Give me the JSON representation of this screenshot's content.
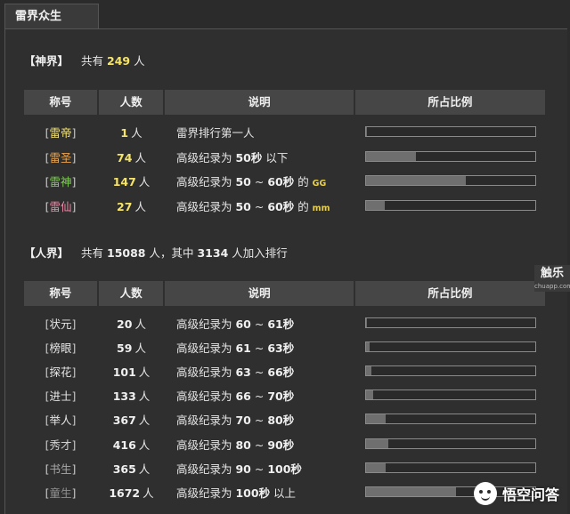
{
  "tab": {
    "label": "雷界众生"
  },
  "shen": {
    "bracket": "【神界】",
    "prefix": "共有",
    "count": "249",
    "suffix": "人",
    "headers": [
      "称号",
      "人数",
      "说明",
      "所占比例"
    ],
    "rows": [
      {
        "title": "雷帝",
        "color": "#f6e46a",
        "count": "1",
        "unit": "人",
        "desc_pre": "雷界排行第一人",
        "desc_b1": "",
        "desc_mid": "",
        "desc_b2": "",
        "desc_post": "",
        "small": "",
        "ratio": 0.004,
        "count_color": "#f6e46a"
      },
      {
        "title": "雷圣",
        "color": "#f0a64a",
        "count": "74",
        "unit": "人",
        "desc_pre": "高级纪录为 ",
        "desc_b1": "50秒",
        "desc_mid": " 以下",
        "desc_b2": "",
        "desc_post": "",
        "small": "",
        "ratio": 0.297,
        "count_color": "#f6e46a"
      },
      {
        "title": "雷神",
        "color": "#7bd24c",
        "count": "147",
        "unit": "人",
        "desc_pre": "高级纪录为 ",
        "desc_b1": "50",
        "desc_mid": " ~ ",
        "desc_b2": "60秒",
        "desc_post": " 的 ",
        "small": "GG",
        "small_color": "#e8d04a",
        "ratio": 0.59,
        "count_color": "#f6e46a"
      },
      {
        "title": "雷仙",
        "color": "#f08aa8",
        "count": "27",
        "unit": "人",
        "desc_pre": "高级纪录为 ",
        "desc_b1": "50",
        "desc_mid": " ~ ",
        "desc_b2": "60秒",
        "desc_post": " 的 ",
        "small": "mm",
        "small_color": "#e8d04a",
        "ratio": 0.108,
        "count_color": "#f6e46a"
      }
    ]
  },
  "ren": {
    "bracket": "【人界】",
    "prefix": "共有",
    "count": "15088",
    "mid": "人，其中",
    "count2": "3134",
    "suffix": "人加入排行",
    "headers": [
      "称号",
      "人数",
      "说明",
      "所占比例"
    ],
    "rows": [
      {
        "title": "状元",
        "color": "#e6e6e6",
        "count": "20",
        "unit": "人",
        "desc_pre": "高级纪录为 ",
        "desc_b1": "60",
        "desc_mid": " ~ ",
        "desc_b2": "61秒",
        "desc_post": "",
        "ratio": 0.006
      },
      {
        "title": "榜眼",
        "color": "#e6e6e6",
        "count": "59",
        "unit": "人",
        "desc_pre": "高级纪录为 ",
        "desc_b1": "61",
        "desc_mid": " ~ ",
        "desc_b2": "63秒",
        "desc_post": "",
        "ratio": 0.019
      },
      {
        "title": "探花",
        "color": "#e6e6e6",
        "count": "101",
        "unit": "人",
        "desc_pre": "高级纪录为 ",
        "desc_b1": "63",
        "desc_mid": " ~ ",
        "desc_b2": "66秒",
        "desc_post": "",
        "ratio": 0.032
      },
      {
        "title": "进士",
        "color": "#e6e6e6",
        "count": "133",
        "unit": "人",
        "desc_pre": "高级纪录为 ",
        "desc_b1": "66",
        "desc_mid": " ~ ",
        "desc_b2": "70秒",
        "desc_post": "",
        "ratio": 0.042
      },
      {
        "title": "举人",
        "color": "#e6e6e6",
        "count": "367",
        "unit": "人",
        "desc_pre": "高级纪录为 ",
        "desc_b1": "70",
        "desc_mid": " ~ ",
        "desc_b2": "80秒",
        "desc_post": "",
        "ratio": 0.117
      },
      {
        "title": "秀才",
        "color": "#d0d0d0",
        "count": "416",
        "unit": "人",
        "desc_pre": "高级纪录为 ",
        "desc_b1": "80",
        "desc_mid": " ~ ",
        "desc_b2": "90秒",
        "desc_post": "",
        "ratio": 0.133
      },
      {
        "title": "书生",
        "color": "#a8a8a8",
        "count": "365",
        "unit": "人",
        "desc_pre": "高级纪录为 ",
        "desc_b1": "90",
        "desc_mid": " ~ ",
        "desc_b2": "100秒",
        "desc_post": "",
        "ratio": 0.116
      },
      {
        "title": "童生",
        "color": "#909090",
        "count": "1672",
        "unit": "人",
        "desc_pre": "高级纪录为 ",
        "desc_b1": "100秒",
        "desc_mid": " 以上",
        "desc_b2": "",
        "desc_post": "",
        "ratio": 0.533
      }
    ]
  },
  "watermarks": {
    "side_main": "触乐",
    "side_sub": "chuapp.com",
    "brand": "悟空问答"
  }
}
